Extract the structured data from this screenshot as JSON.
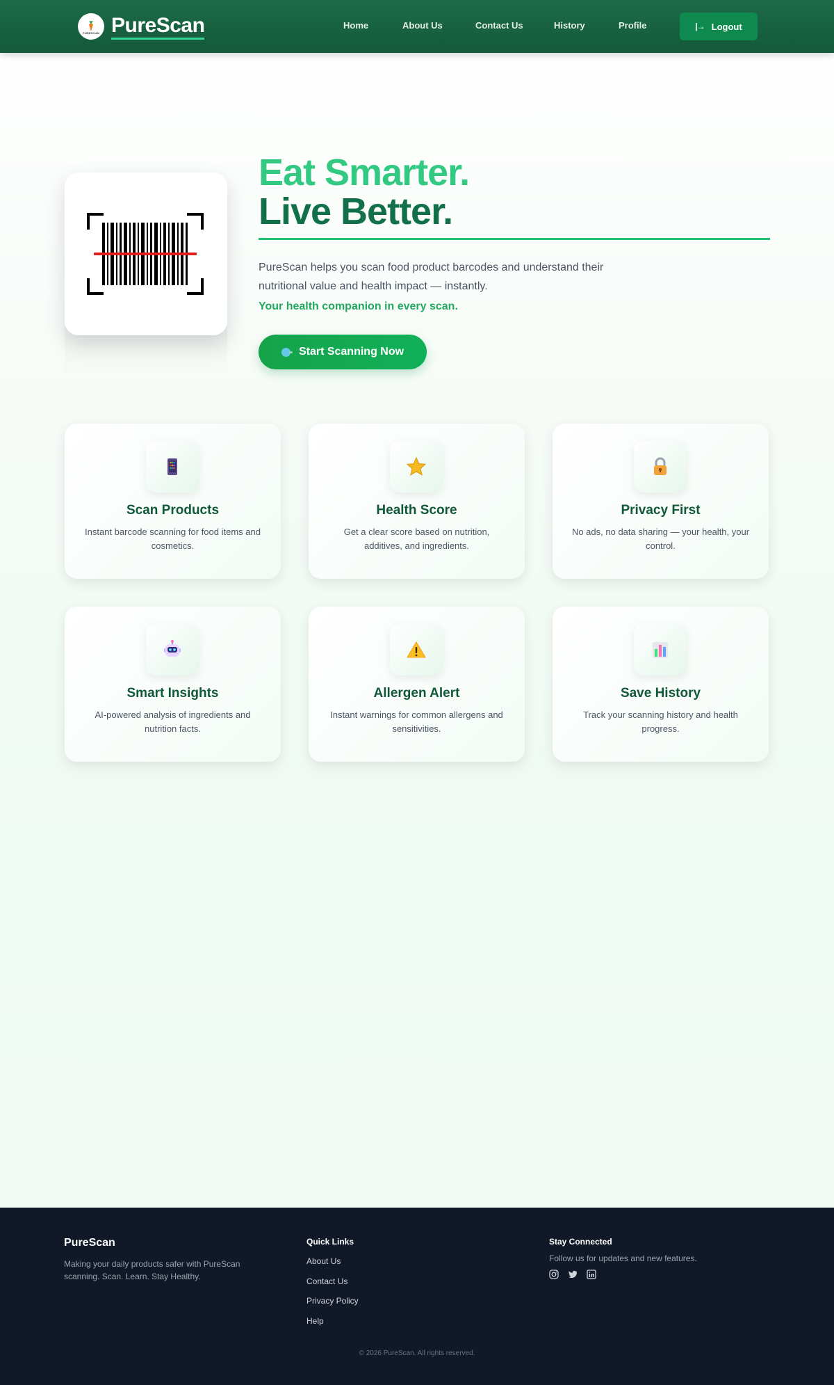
{
  "navbar": {
    "brand_name": "PureScan",
    "logo_text": "PURESCAN",
    "links": [
      "Home",
      "About Us",
      "Contact Us",
      "History",
      "Profile"
    ],
    "logout_label": "Logout"
  },
  "hero": {
    "title_line1": "Eat Smarter.",
    "title_line2": "Live Better.",
    "description": "PureScan helps you scan food product barcodes and understand their nutritional value and health impact — instantly.",
    "tagline": "Your health companion in every scan.",
    "cta_label": "Start Scanning Now"
  },
  "features": [
    {
      "icon": "phone-icon",
      "title": "Scan Products",
      "description": "Instant barcode scanning for food items and cosmetics."
    },
    {
      "icon": "star-icon",
      "title": "Health Score",
      "description": "Get a clear score based on nutrition, additives, and ingredients."
    },
    {
      "icon": "lock-icon",
      "title": "Privacy First",
      "description": "No ads, no data sharing — your health, your control."
    },
    {
      "icon": "robot-icon",
      "title": "Smart Insights",
      "description": "AI-powered analysis of ingredients and nutrition facts."
    },
    {
      "icon": "warning-icon",
      "title": "Allergen Alert",
      "description": "Instant warnings for common allergens and sensitivities."
    },
    {
      "icon": "bar-chart-icon",
      "title": "Save History",
      "description": "Track your scanning history and health progress."
    }
  ],
  "footer": {
    "brand": "PureScan",
    "tagline": "Making your daily products safer with PureScan scanning. Scan. Learn. Stay Healthy.",
    "quick_links_heading": "Quick Links",
    "quick_links": [
      "About Us",
      "Contact Us",
      "Privacy Policy",
      "Help"
    ],
    "stay_connected_heading": "Stay Connected",
    "follow_text": "Follow us for updates and new features.",
    "social": [
      "instagram-icon",
      "twitter-icon",
      "linkedin-icon"
    ],
    "copyright": "© 2026 PureScan. All rights reserved."
  },
  "colors": {
    "nav_bg": "#13593a",
    "accent_green": "#22c172",
    "title_light": "#34c982",
    "title_dark": "#11704a",
    "footer_bg": "#111827"
  }
}
